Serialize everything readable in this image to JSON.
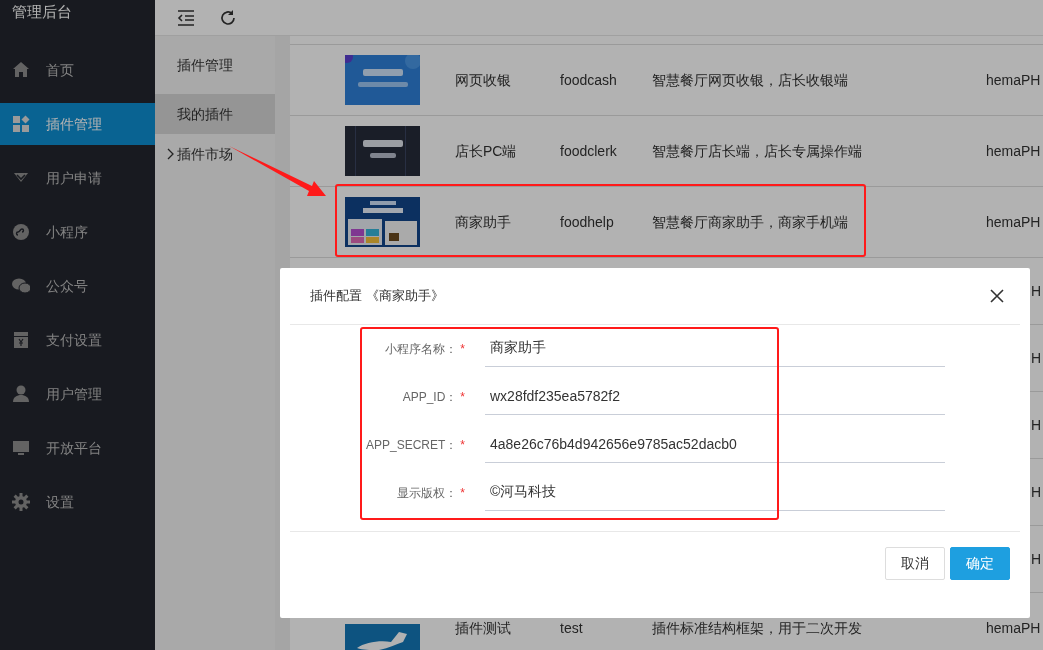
{
  "sidebar": {
    "title": "管理后台",
    "items": [
      {
        "label": "首页",
        "selected": false
      },
      {
        "label": "插件管理",
        "selected": true
      },
      {
        "label": "用户申请",
        "selected": false
      },
      {
        "label": "小程序",
        "selected": false
      },
      {
        "label": "公众号",
        "selected": false
      },
      {
        "label": "支付设置",
        "selected": false
      },
      {
        "label": "用户管理",
        "selected": false
      },
      {
        "label": "开放平台",
        "selected": false
      },
      {
        "label": "设置",
        "selected": false
      }
    ]
  },
  "subnav": {
    "title": "插件管理",
    "items": [
      {
        "label": "我的插件",
        "selected": true,
        "kind": "item"
      },
      {
        "label": "插件市场",
        "selected": false,
        "kind": "folder"
      }
    ]
  },
  "table": {
    "rows": [
      {
        "kind": "visible",
        "name": "网页收银",
        "code": "foodcash",
        "description": "智慧餐厅网页收银，店长收银端",
        "author": "hemaPH"
      },
      {
        "kind": "visible",
        "name": "店长PC端",
        "code": "foodclerk",
        "description": "智慧餐厅店长端，店长专属操作端",
        "author": "hemaPH"
      },
      {
        "kind": "visible",
        "name": "商家助手",
        "code": "foodhelp",
        "description": "智慧餐厅商家助手，商家手机端",
        "author": "hemaPH"
      },
      {
        "kind": "covered",
        "author": "H"
      },
      {
        "kind": "covered",
        "author": "H"
      },
      {
        "kind": "covered",
        "author": "H"
      },
      {
        "kind": "covered",
        "author": "H"
      },
      {
        "kind": "covered",
        "author": "H"
      },
      {
        "kind": "visible",
        "name": "插件测试",
        "code": "test",
        "description": "插件标准结构框架，用于二次开发",
        "author": "hemaPH"
      }
    ]
  },
  "dialog": {
    "title": "插件配置 《商家助手》",
    "fields": [
      {
        "label": "小程序名称：",
        "required_mark": "*",
        "value": "商家助手"
      },
      {
        "label": "APP_ID：",
        "required_mark": "*",
        "value": "wx28fdf235ea5782f2"
      },
      {
        "label": "APP_SECRET：",
        "required_mark": "*",
        "value": "4a8e26c76b4d942656e9785ac52dacb0"
      },
      {
        "label": "显示版权：",
        "required_mark": "*",
        "value": "©河马科技"
      }
    ],
    "buttons": [
      {
        "label": "取消",
        "kind": "default"
      },
      {
        "label": "确定",
        "kind": "primary"
      }
    ]
  }
}
